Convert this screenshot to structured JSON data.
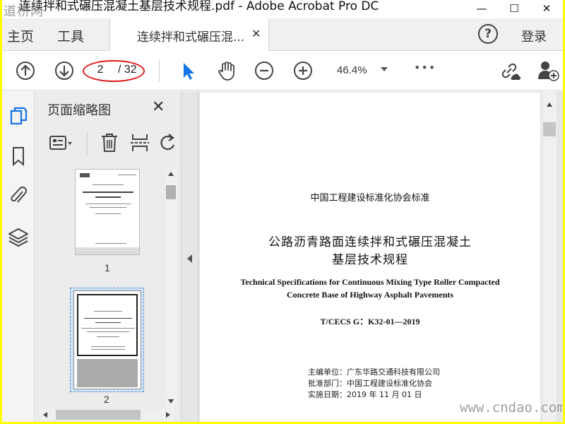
{
  "window": {
    "title": "连续拌和式碾压混凝土基层技术规程.pdf - Adobe Acrobat Pro DC",
    "watermark_top": "道桥网",
    "minimize": "—",
    "maximize": "☐",
    "close": "✕"
  },
  "menubar": {
    "home": "主页",
    "tools": "工具",
    "doc_tab_label": "连续拌和式碾压混...",
    "doc_tab_close": "✕",
    "help": "?",
    "login": "登录"
  },
  "toolbar": {
    "current_page": "2",
    "total_pages": "/ 32",
    "zoom": "46.4%",
    "more": "•••"
  },
  "thumbnail_panel": {
    "title": "页面缩略图",
    "close": "✕",
    "thumbs": [
      {
        "label": "1"
      },
      {
        "label": "2"
      }
    ]
  },
  "document": {
    "std_org": "中国工程建设标准化协会标准",
    "title_cn_1": "公路沥青路面连续拌和式碾压混凝土",
    "title_cn_2": "基层技术规程",
    "title_en_1": "Technical Specifications for Continuous Mixing Type Roller Compacted",
    "title_en_2": "Concrete Base of Highway Asphalt Pavements",
    "std_code": "T/CECS G：K32-01—2019",
    "editor": "主编单位：广东华路交通科技有限公司",
    "approver": "批准部门：中国工程建设标准化协会",
    "effective": "实施日期：2019 年 11 月 01 日"
  },
  "watermark_bottom": "www.cndao.com",
  "colors": {
    "accent_blue": "#1473e6",
    "annotation_red": "#e01b1b",
    "outer_border": "#ffff00"
  }
}
